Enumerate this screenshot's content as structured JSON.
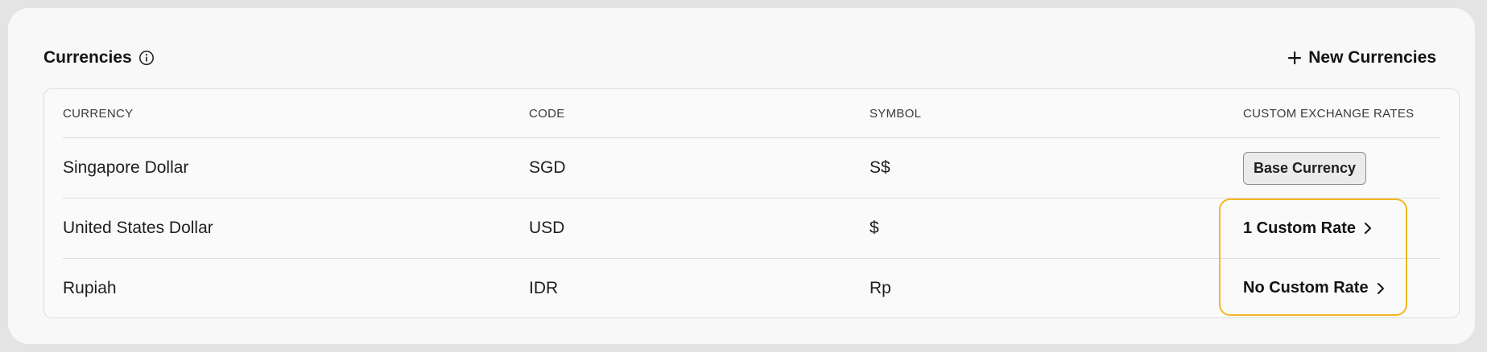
{
  "section": {
    "title": "Currencies",
    "new_button_label": "New Currencies"
  },
  "table": {
    "headers": [
      "CURRENCY",
      "CODE",
      "SYMBOL",
      "CUSTOM EXCHANGE RATES"
    ],
    "rows": [
      {
        "currency": "Singapore Dollar",
        "code": "SGD",
        "symbol": "S$",
        "rate": "Base Currency"
      },
      {
        "currency": "United States Dollar",
        "code": "USD",
        "symbol": "$",
        "rate": "1 Custom Rate"
      },
      {
        "currency": "Rupiah",
        "code": "IDR",
        "symbol": "Rp",
        "rate": "No Custom Rate"
      }
    ]
  },
  "colors": {
    "highlight": "#f4b722",
    "page_background": "#f8f8f8",
    "outer_background": "#e4e4e4"
  },
  "icons": {
    "info": "info-icon",
    "plus": "plus-icon",
    "chevron": "chevron-right-icon"
  }
}
